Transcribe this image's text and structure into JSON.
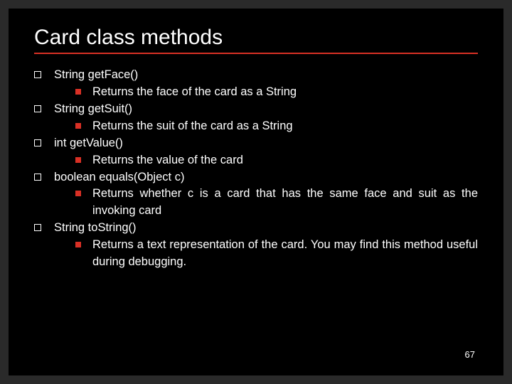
{
  "title": "Card class methods",
  "methods": [
    {
      "sig": "String getFace()",
      "desc": "Returns the face of the card as a String"
    },
    {
      "sig": "String getSuit()",
      "desc": "Returns the suit of the card as a String"
    },
    {
      "sig": "int getValue()",
      "desc": "Returns the value of the card"
    },
    {
      "sig": "boolean equals(Object c)",
      "desc": "Returns whether c is a card that has the same face and suit as the invoking card"
    },
    {
      "sig": "String toString()",
      "desc": "Returns a text representation of the card. You may find this method useful during debugging."
    }
  ],
  "page": "67"
}
